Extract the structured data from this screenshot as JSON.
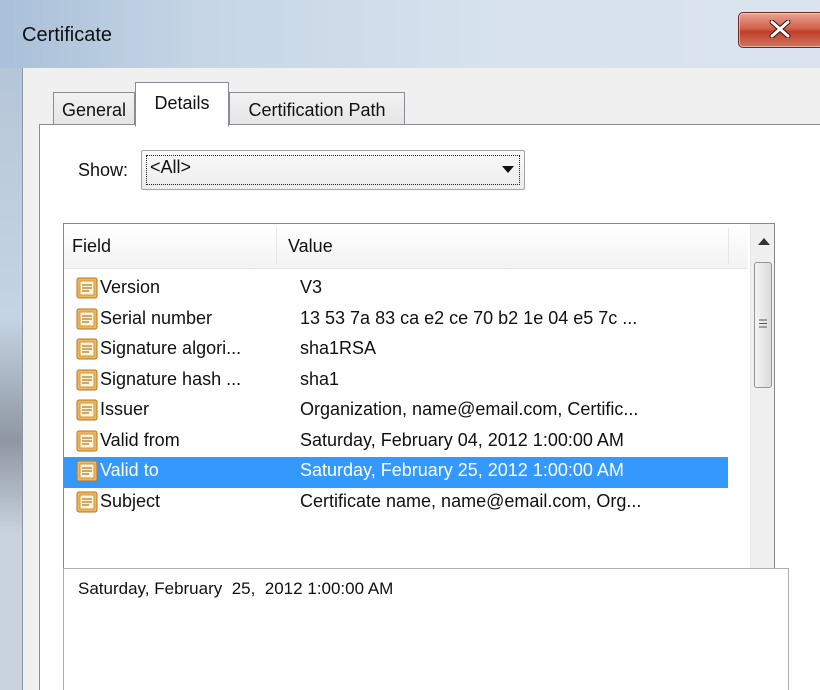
{
  "window": {
    "title": "Certificate"
  },
  "tabs": [
    {
      "label": "General"
    },
    {
      "label": "Details"
    },
    {
      "label": "Certification Path"
    }
  ],
  "show": {
    "label": "Show:",
    "selected": "<All>"
  },
  "list": {
    "columns": [
      "Field",
      "Value"
    ],
    "rows": [
      {
        "field": "Version",
        "value": "V3"
      },
      {
        "field": "Serial number",
        "value": "13 53 7a 83 ca e2 ce 70 b2 1e 04 e5 7c ..."
      },
      {
        "field": "Signature algori...",
        "value": "sha1RSA"
      },
      {
        "field": "Signature hash ...",
        "value": "sha1"
      },
      {
        "field": "Issuer",
        "value": "Organization, name@email.com, Certific..."
      },
      {
        "field": "Valid from",
        "value": "Saturday, February 04, 2012 1:00:00 AM"
      },
      {
        "field": "Valid to",
        "value": "Saturday, February 25, 2012 1:00:00 AM"
      },
      {
        "field": "Subject",
        "value": "Certificate name, name@email.com, Org..."
      }
    ],
    "selected_index": 6
  },
  "detail": {
    "text": "Saturday, February  25,  2012 1:00:00 AM"
  },
  "colors": {
    "selection": "#3399ff",
    "close_button": "#c9452f"
  }
}
